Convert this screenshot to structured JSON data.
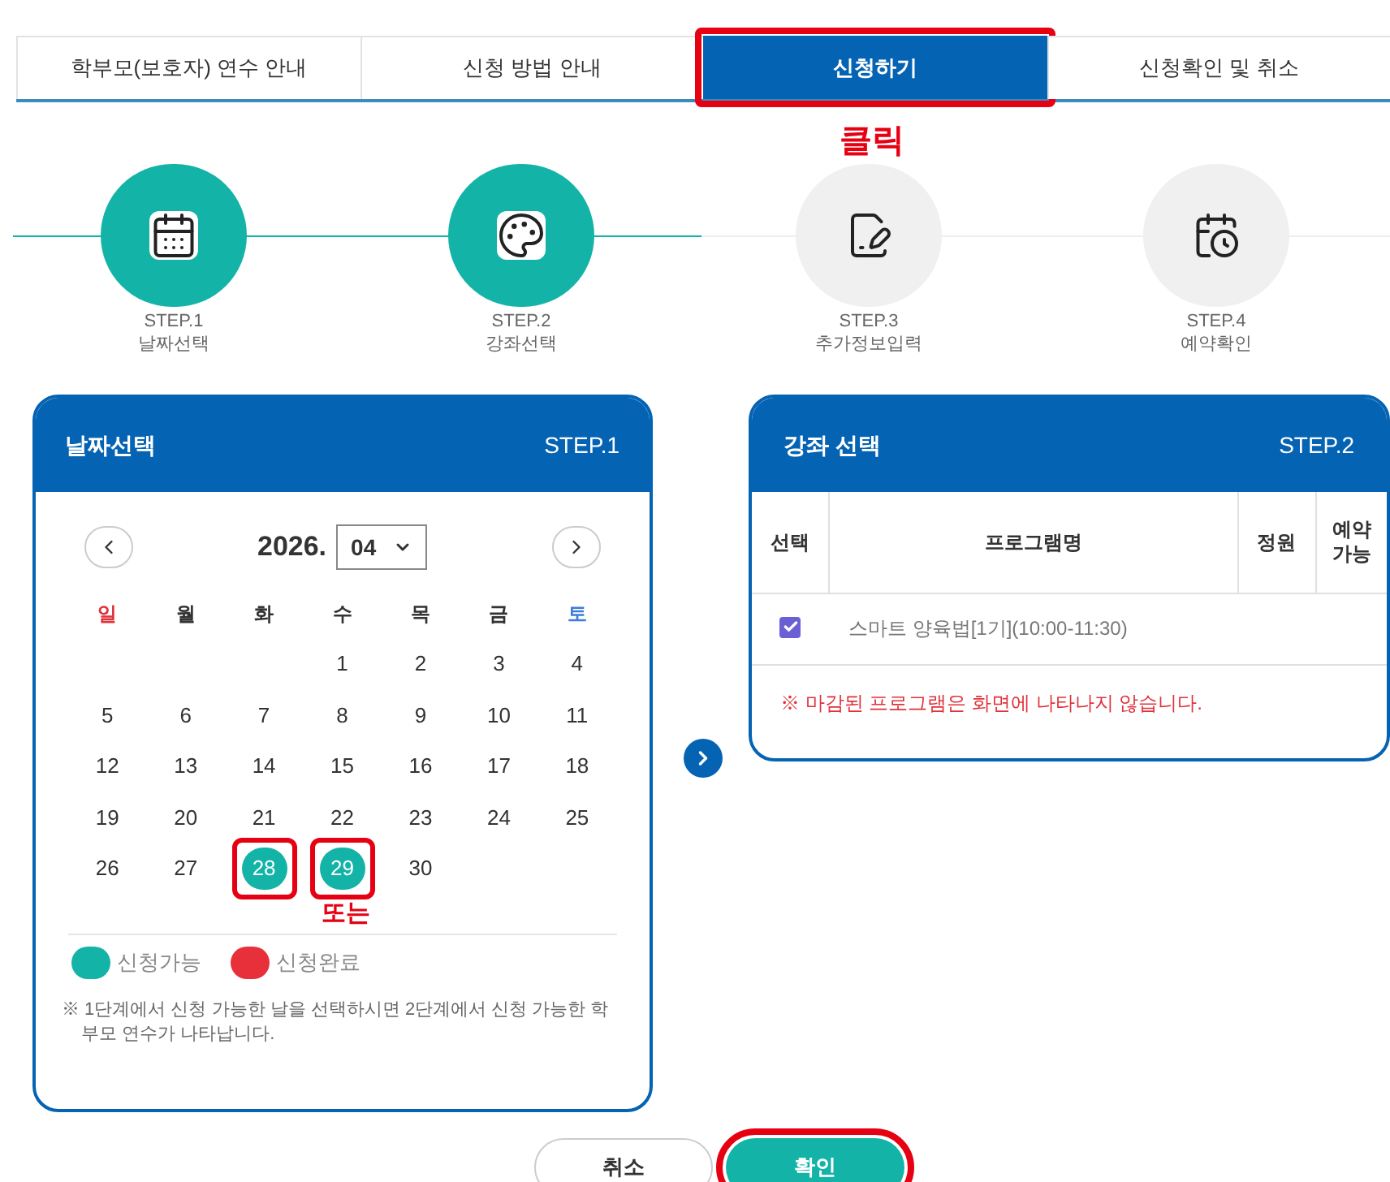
{
  "tabs": [
    {
      "label": "학부모(보호자) 연수 안내",
      "selected": false,
      "annotated": false
    },
    {
      "label": "신청 방법 안내",
      "selected": false,
      "annotated": false
    },
    {
      "label": "신청하기",
      "selected": true,
      "annotated": true
    },
    {
      "label": "신청확인 및 취소",
      "selected": false,
      "annotated": false
    }
  ],
  "click_note": "클릭",
  "steps": [
    {
      "step": "STEP.1",
      "label": "날짜선택",
      "active": true,
      "kind": "calendar"
    },
    {
      "step": "STEP.2",
      "label": "강좌선택",
      "active": true,
      "kind": "palette"
    },
    {
      "step": "STEP.3",
      "label": "추가정보입력",
      "active": false,
      "kind": "form"
    },
    {
      "step": "STEP.4",
      "label": "예약확인",
      "active": false,
      "kind": "confirm"
    }
  ],
  "date_panel": {
    "title": "날짜선택",
    "step": "STEP.1",
    "year": "2026.",
    "month": "04",
    "weekdays": [
      {
        "label": "일",
        "kind": "sunday"
      },
      {
        "label": "월",
        "kind": "weekday"
      },
      {
        "label": "화",
        "kind": "weekday"
      },
      {
        "label": "수",
        "kind": "weekday"
      },
      {
        "label": "목",
        "kind": "weekday"
      },
      {
        "label": "금",
        "kind": "weekday"
      },
      {
        "label": "토",
        "kind": "saturday"
      }
    ],
    "weeks": [
      [
        {
          "day": "1",
          "available": false,
          "annotated": false
        },
        {
          "day": "2",
          "available": false,
          "annotated": false
        },
        {
          "day": "3",
          "available": false,
          "annotated": false
        },
        {
          "day": "4",
          "available": false,
          "annotated": false
        }
      ],
      [
        {
          "day": "5",
          "available": false,
          "annotated": false
        },
        {
          "day": "6",
          "available": false,
          "annotated": false
        },
        {
          "day": "7",
          "available": false,
          "annotated": false
        },
        {
          "day": "8",
          "available": false,
          "annotated": false
        },
        {
          "day": "9",
          "available": false,
          "annotated": false
        },
        {
          "day": "10",
          "available": false,
          "annotated": false
        },
        {
          "day": "11",
          "available": false,
          "annotated": false
        }
      ],
      [
        {
          "day": "12",
          "available": false,
          "annotated": false
        },
        {
          "day": "13",
          "available": false,
          "annotated": false
        },
        {
          "day": "14",
          "available": false,
          "annotated": false
        },
        {
          "day": "15",
          "available": false,
          "annotated": false
        },
        {
          "day": "16",
          "available": false,
          "annotated": false
        },
        {
          "day": "17",
          "available": false,
          "annotated": false
        },
        {
          "day": "18",
          "available": false,
          "annotated": false
        }
      ],
      [
        {
          "day": "19",
          "available": false,
          "annotated": false
        },
        {
          "day": "20",
          "available": false,
          "annotated": false
        },
        {
          "day": "21",
          "available": false,
          "annotated": false
        },
        {
          "day": "22",
          "available": false,
          "annotated": false
        },
        {
          "day": "23",
          "available": false,
          "annotated": false
        },
        {
          "day": "24",
          "available": false,
          "annotated": false
        },
        {
          "day": "25",
          "available": false,
          "annotated": false
        }
      ],
      [
        {
          "day": "26",
          "available": false,
          "annotated": false
        },
        {
          "day": "27",
          "available": false,
          "annotated": false
        },
        {
          "day": "28",
          "available": true,
          "annotated": true
        },
        {
          "day": "29",
          "available": true,
          "annotated": true
        },
        {
          "day": "30",
          "available": false,
          "annotated": false
        }
      ]
    ],
    "or_note": "또는",
    "legend": [
      {
        "label": "신청가능",
        "color": "#14b3a8"
      },
      {
        "label": "신청완료",
        "color": "#e8303a"
      }
    ],
    "note": "※ 1단계에서 신청 가능한 날을 선택하시면 2단계에서 신청 가능한 학부모 연수가 나타납니다."
  },
  "course_panel": {
    "title": "강좌 선택",
    "step": "STEP.2",
    "columns": [
      "선택",
      "프로그램명",
      "정원",
      "예약 가능"
    ],
    "rows": [
      {
        "checked": true,
        "program": "스마트 양육법[1기](10:00-11:30)"
      }
    ],
    "notice": "※ 마감된 프로그램은 화면에 나타나지 않습니다."
  },
  "buttons": [
    {
      "label": "취소",
      "kind": "secondary",
      "annotated": false
    },
    {
      "label": "확인",
      "kind": "primary",
      "annotated": true
    }
  ]
}
